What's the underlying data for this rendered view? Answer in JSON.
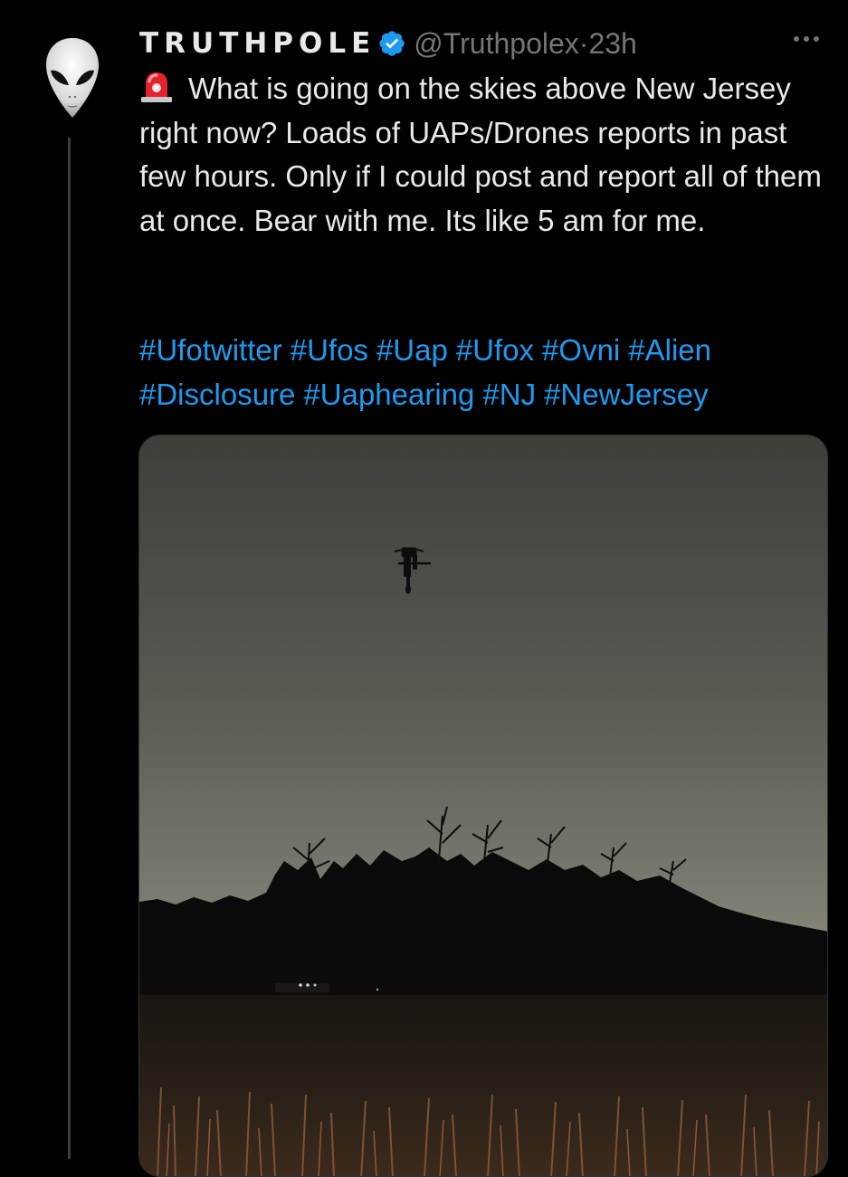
{
  "tweet": {
    "display_name": "TRUTHPOLE",
    "handle": "@Truthpolex",
    "separator": "·",
    "time": "23h",
    "body": "What is going on the skies above New Jersey right now? Loads of UAPs/Drones reports in past few hours. Only if I could post and report all of them at once. Bear with me. Its like 5 am for me.",
    "hashtags": [
      "#Ufotwitter",
      "#Ufos",
      "#Uap",
      "#Ufox",
      "#Ovni",
      "#Alien",
      "#Disclosure",
      "#Uaphearing",
      "#NJ",
      "#NewJersey"
    ]
  },
  "icons": {
    "avatar": "alien-head-icon",
    "verified": "verified-badge-icon",
    "more": "more-options-icon",
    "siren": "police-siren-emoji"
  },
  "colors": {
    "background": "#000000",
    "primary_text": "#e7e9ea",
    "secondary_text": "#71767b",
    "link": "#1d9bf0",
    "verified": "#1d9bf0",
    "thread_line": "#3a3d40"
  }
}
